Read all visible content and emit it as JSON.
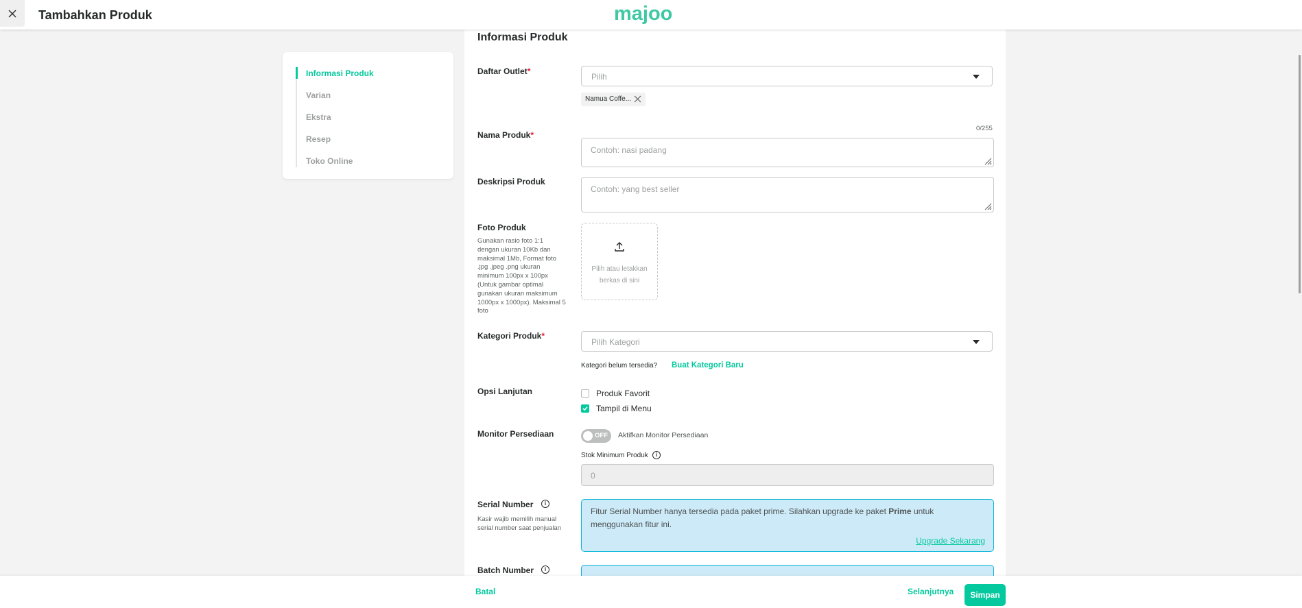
{
  "header": {
    "title": "Tambahkan Produk",
    "logo_text": "majoo"
  },
  "sidenav": {
    "items": [
      {
        "label": "Informasi Produk",
        "active": true
      },
      {
        "label": "Varian",
        "active": false
      },
      {
        "label": "Ekstra",
        "active": false
      },
      {
        "label": "Resep",
        "active": false
      },
      {
        "label": "Toko Online",
        "active": false
      }
    ]
  },
  "form": {
    "section_title": "Informasi Produk",
    "outlet": {
      "label": "Daftar Outlet",
      "required_mark": "*",
      "placeholder": "Pilih",
      "selected_chip": "Namua Coffe..."
    },
    "product_name": {
      "label": "Nama Produk",
      "required_mark": "*",
      "counter": "0/255",
      "placeholder": "Contoh: nasi padang"
    },
    "description": {
      "label": "Deskripsi Produk",
      "placeholder": "Contoh: yang best seller"
    },
    "photo": {
      "label": "Foto Produk",
      "help": "Gunakan rasio foto 1:1 dengan ukuran 10Kb dan maksimal 1Mb, Format foto .jpg .jpeg .png ukuran minimum 100px x 100px (Untuk gambar optimal gunakan ukuran maksimum 1000px x 1000px). Maksimal 5 foto",
      "upload_text": "Pilih atau letakkan berkas di sini"
    },
    "category": {
      "label": "Kategori Produk",
      "required_mark": "*",
      "placeholder": "Pilih Kategori",
      "missing_text": "Kategori belum tersedia?",
      "create_link": "Buat Kategori Baru"
    },
    "options": {
      "label": "Opsi Lanjutan",
      "favorite_label": "Produk Favorit",
      "favorite_checked": false,
      "show_menu_label": "Tampil di Menu",
      "show_menu_checked": true
    },
    "stock": {
      "label": "Monitor Persediaan",
      "toggle_text": "OFF",
      "toggle_label": "Aktifkan Monitor Persediaan",
      "min_stock_label": "Stok Minimum Produk",
      "min_stock_value": "0"
    },
    "serial": {
      "label": "Serial Number",
      "help": "Kasir wajib memilih manual serial number saat penjualan",
      "message_before": "Fitur Serial Number hanya tersedia pada paket prime. Silahkan upgrade ke paket ",
      "message_bold": "Prime",
      "message_after": " untuk menggunakan fitur ini.",
      "upgrade_link": "Upgrade Sekarang"
    },
    "batch": {
      "label": "Batch Number"
    }
  },
  "footer": {
    "cancel": "Batal",
    "next": "Selanjutnya",
    "save": "Simpan"
  },
  "colors": {
    "brand": "#04c99e",
    "info_bg": "#cdeaf8",
    "info_border": "#08b5d8",
    "required": "#e21d2f"
  }
}
